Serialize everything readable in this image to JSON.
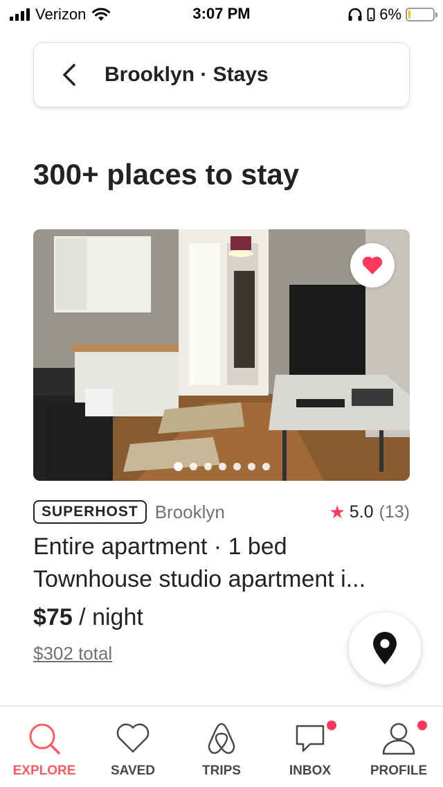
{
  "status_bar": {
    "carrier": "Verizon",
    "time": "3:07 PM",
    "battery": "6%",
    "battery_level": 0.06
  },
  "header": {
    "title": "Brooklyn · Stays",
    "back_icon": "chevron-left-icon"
  },
  "results_title": "300+ places to stay",
  "listing": {
    "badge": "SUPERHOST",
    "location": "Brooklyn",
    "rating": "5.0",
    "review_count": "(13)",
    "type": "Entire apartment · 1 bed",
    "name": "Townhouse studio apartment i...",
    "price": "$75",
    "price_suffix": " / night",
    "total": "$302 total",
    "photo_count": 7,
    "active_photo": 0,
    "favorited": true
  },
  "colors": {
    "brand": "#ff5a5f",
    "accent_red": "#ff385c",
    "text": "#222222",
    "muted": "#717171"
  },
  "tabs": [
    {
      "label": "EXPLORE",
      "icon": "search-icon",
      "active": true
    },
    {
      "label": "SAVED",
      "icon": "heart-icon",
      "active": false
    },
    {
      "label": "TRIPS",
      "icon": "airbnb-logo-icon",
      "active": false
    },
    {
      "label": "INBOX",
      "icon": "message-icon",
      "active": false,
      "notification": true
    },
    {
      "label": "PROFILE",
      "icon": "user-icon",
      "active": false,
      "notification": true
    }
  ]
}
